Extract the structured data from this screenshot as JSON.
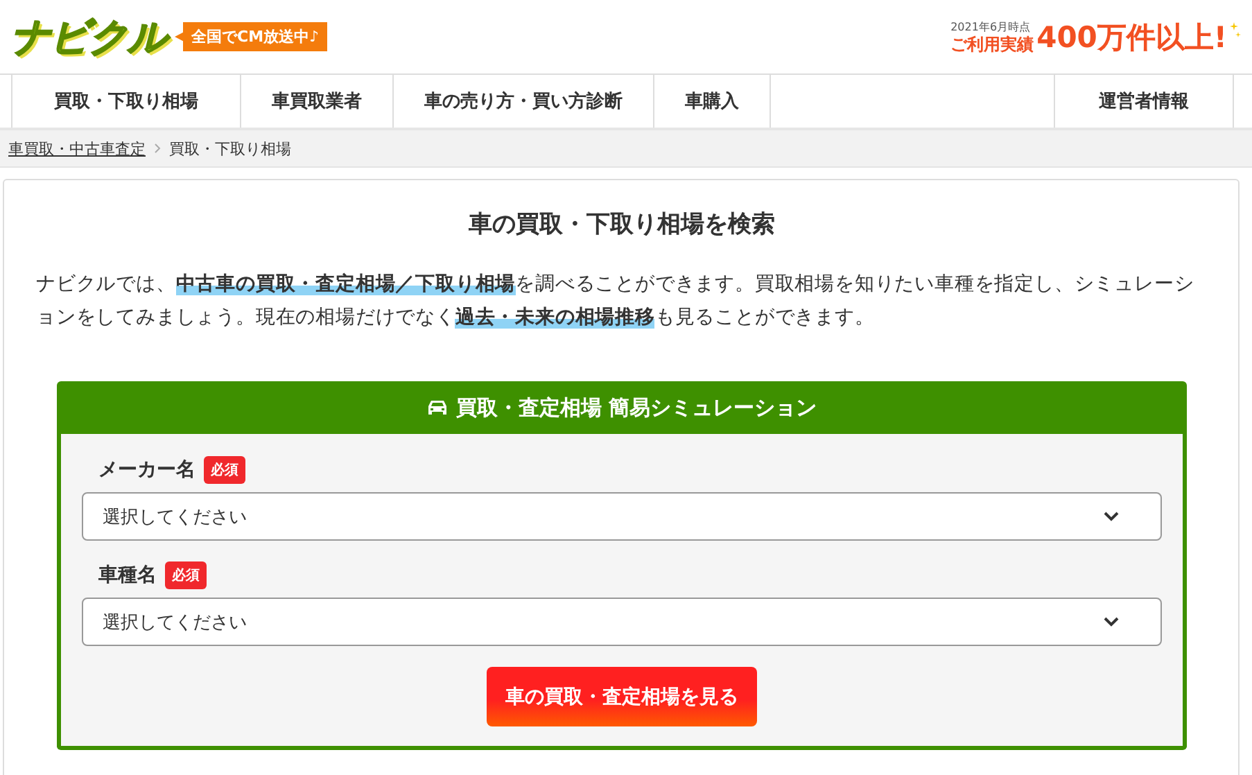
{
  "header": {
    "logo": "ナビクル",
    "badge": "全国でCM放送中♪",
    "stats": {
      "as_of": "2021年6月時点",
      "label": "ご利用実績",
      "count": "400万件以上!"
    }
  },
  "nav": [
    {
      "kind": "link",
      "label": "買取・下取り相場"
    },
    {
      "kind": "link",
      "label": "車買取業者"
    },
    {
      "kind": "link",
      "label": "車の売り方・買い方診断"
    },
    {
      "kind": "link",
      "label": "車購入"
    },
    {
      "kind": "spacer"
    },
    {
      "kind": "link",
      "label": "運営者情報"
    }
  ],
  "breadcrumb": [
    {
      "label": "車買取・中古車査定",
      "link": true
    },
    {
      "label": "買取・下取り相場",
      "link": false
    }
  ],
  "main": {
    "title": "車の買取・下取り相場を検索",
    "intro": "ナビクルでは、**中古車の買取・査定相場／下取り相場**を調べることができます。買取相場を知りたい車種を指定し、シミュレーションをしてみましょう。現在の相場だけでなく**過去・未来の相場推移**も見ることができます。"
  },
  "simulator": {
    "title": "買取・査定相場 簡易シミュレーション",
    "fields": [
      {
        "label": "メーカー名",
        "required": true,
        "badge": "必須",
        "placeholder": "選択してください"
      },
      {
        "label": "車種名",
        "required": true,
        "badge": "必須",
        "placeholder": "選択してください"
      }
    ],
    "button": "車の買取・査定相場を見る"
  }
}
